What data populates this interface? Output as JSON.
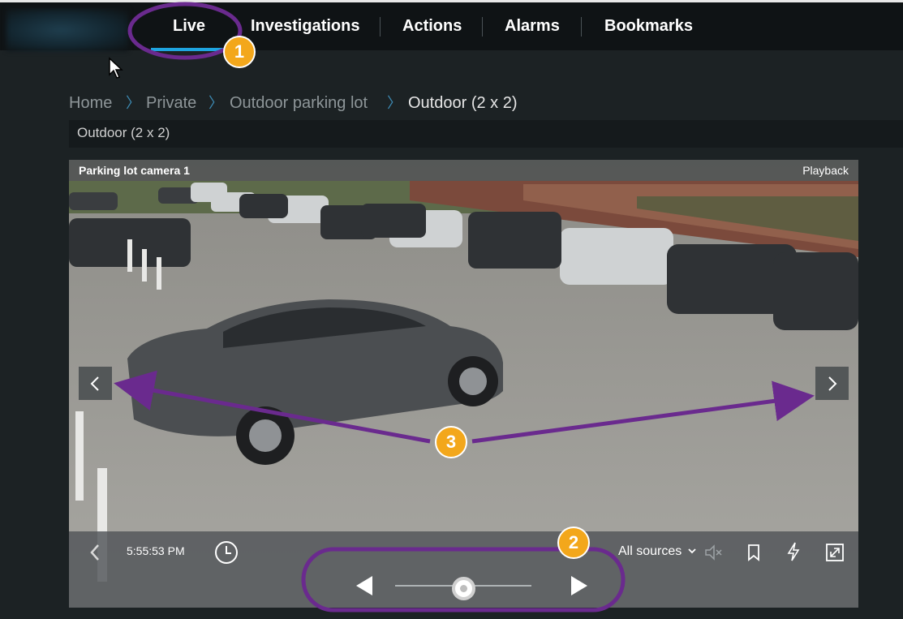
{
  "nav": {
    "tabs": [
      {
        "label": "Live"
      },
      {
        "label": "Investigations"
      },
      {
        "label": "Actions"
      },
      {
        "label": "Alarms"
      },
      {
        "label": "Bookmarks"
      }
    ]
  },
  "breadcrumb": [
    "Home",
    "Private",
    "Outdoor parking lot",
    "Outdoor (2 x 2)"
  ],
  "view": {
    "title": "Outdoor (2 x 2)"
  },
  "camera": {
    "name": "Parking lot camera 1",
    "mode": "Playback",
    "time": "5:55:53 PM",
    "sources_label": "All sources"
  },
  "annotations": {
    "badges": [
      "1",
      "2",
      "3"
    ],
    "color": "#6a2a8e",
    "badge_color": "#f3a71b"
  },
  "colors": {
    "accent": "#1ea5e0"
  }
}
